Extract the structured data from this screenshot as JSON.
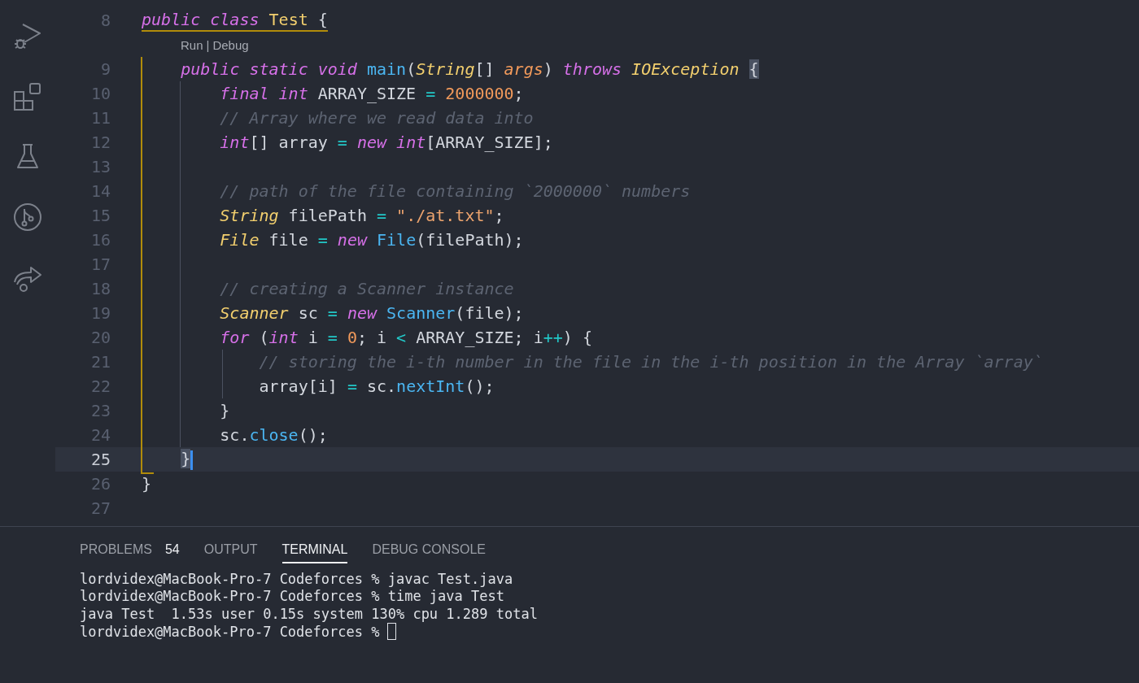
{
  "activity_bar": [
    {
      "kind": "run-debug",
      "selected": false
    },
    {
      "kind": "extensions",
      "selected": false
    },
    {
      "kind": "flask",
      "selected": false
    },
    {
      "kind": "branch",
      "selected": false
    },
    {
      "kind": "share",
      "selected": false
    }
  ],
  "editor": {
    "lines": [
      {
        "number": "8",
        "current": false,
        "tokens": [
          {
            "kind": "kw",
            "text": "public class "
          },
          {
            "kind": "cls",
            "text": "Test"
          },
          {
            "kind": "plain",
            "text": " {"
          }
        ],
        "codelens": {
          "links": [
            "Run",
            "Debug"
          ],
          "separator": "|"
        }
      },
      {
        "number": "9",
        "current": false,
        "tokens": [
          {
            "kind": "kw",
            "text": "    public static void "
          },
          {
            "kind": "fn",
            "text": "main"
          },
          {
            "kind": "plain",
            "text": "("
          },
          {
            "kind": "type",
            "text": "String"
          },
          {
            "kind": "plain",
            "text": "[] "
          },
          {
            "kind": "param",
            "text": "args"
          },
          {
            "kind": "plain",
            "text": ") "
          },
          {
            "kind": "kw",
            "text": "throws "
          },
          {
            "kind": "type",
            "text": "IOException "
          },
          {
            "kind": "bracket",
            "text": "{"
          }
        ]
      },
      {
        "number": "10",
        "current": false,
        "tokens": [
          {
            "kind": "kw",
            "text": "        final int"
          },
          {
            "kind": "plain",
            "text": " ARRAY_SIZE "
          },
          {
            "kind": "op",
            "text": "= "
          },
          {
            "kind": "num",
            "text": "2000000"
          },
          {
            "kind": "plain",
            "text": ";"
          }
        ]
      },
      {
        "number": "11",
        "current": false,
        "tokens": [
          {
            "kind": "cmt",
            "text": "        // Array where we read data into"
          }
        ]
      },
      {
        "number": "12",
        "current": false,
        "tokens": [
          {
            "kind": "kw",
            "text": "        int"
          },
          {
            "kind": "plain",
            "text": "[] array "
          },
          {
            "kind": "op",
            "text": "= "
          },
          {
            "kind": "kw",
            "text": "new int"
          },
          {
            "kind": "plain",
            "text": "[ARRAY_SIZE];"
          }
        ]
      },
      {
        "number": "13",
        "current": false
      },
      {
        "number": "14",
        "current": false,
        "tokens": [
          {
            "kind": "cmt",
            "text": "        // path of the file containing `2000000` numbers"
          }
        ]
      },
      {
        "number": "15",
        "current": false,
        "tokens": [
          {
            "kind": "type",
            "text": "        String"
          },
          {
            "kind": "plain",
            "text": " filePath "
          },
          {
            "kind": "op",
            "text": "= "
          },
          {
            "kind": "str",
            "text": "\"./at.txt\""
          },
          {
            "kind": "plain",
            "text": ";"
          }
        ]
      },
      {
        "number": "16",
        "current": false,
        "tokens": [
          {
            "kind": "type",
            "text": "        File"
          },
          {
            "kind": "plain",
            "text": " file "
          },
          {
            "kind": "op",
            "text": "= "
          },
          {
            "kind": "kw",
            "text": "new "
          },
          {
            "kind": "fn",
            "text": "File"
          },
          {
            "kind": "plain",
            "text": "(filePath);"
          }
        ]
      },
      {
        "number": "17",
        "current": false
      },
      {
        "number": "18",
        "current": false,
        "tokens": [
          {
            "kind": "cmt",
            "text": "        // creating a Scanner instance"
          }
        ]
      },
      {
        "number": "19",
        "current": false,
        "tokens": [
          {
            "kind": "type",
            "text": "        Scanner"
          },
          {
            "kind": "plain",
            "text": " sc "
          },
          {
            "kind": "op",
            "text": "= "
          },
          {
            "kind": "kw",
            "text": "new "
          },
          {
            "kind": "fn",
            "text": "Scanner"
          },
          {
            "kind": "plain",
            "text": "(file);"
          }
        ]
      },
      {
        "number": "20",
        "current": false,
        "tokens": [
          {
            "kind": "kw",
            "text": "        for"
          },
          {
            "kind": "plain",
            "text": " ("
          },
          {
            "kind": "kw",
            "text": "int"
          },
          {
            "kind": "plain",
            "text": " i "
          },
          {
            "kind": "op",
            "text": "= "
          },
          {
            "kind": "num",
            "text": "0"
          },
          {
            "kind": "plain",
            "text": "; i "
          },
          {
            "kind": "op",
            "text": "<"
          },
          {
            "kind": "plain",
            "text": " ARRAY_SIZE; i"
          },
          {
            "kind": "op",
            "text": "++"
          },
          {
            "kind": "plain",
            "text": ") {"
          }
        ]
      },
      {
        "number": "21",
        "current": false,
        "tokens": [
          {
            "kind": "cmt",
            "text": "            // storing the i-th number in the file in the i-th position in the Array `array`"
          }
        ]
      },
      {
        "number": "22",
        "current": false,
        "tokens": [
          {
            "kind": "plain",
            "text": "            array[i] "
          },
          {
            "kind": "op",
            "text": "="
          },
          {
            "kind": "plain",
            "text": " sc."
          },
          {
            "kind": "fn",
            "text": "nextInt"
          },
          {
            "kind": "plain",
            "text": "();"
          }
        ]
      },
      {
        "number": "23",
        "current": false,
        "tokens": [
          {
            "kind": "plain",
            "text": "        }"
          }
        ]
      },
      {
        "number": "24",
        "current": false,
        "tokens": [
          {
            "kind": "plain",
            "text": "        sc."
          },
          {
            "kind": "fn",
            "text": "close"
          },
          {
            "kind": "plain",
            "text": "();"
          }
        ]
      },
      {
        "number": "25",
        "current": true,
        "tokens": [
          {
            "kind": "bracket",
            "text": "    }"
          }
        ]
      },
      {
        "number": "26",
        "current": false,
        "tokens": [
          {
            "kind": "plain",
            "text": "}"
          }
        ]
      },
      {
        "number": "27",
        "current": false
      }
    ]
  },
  "panel": {
    "tabs": [
      {
        "label": "PROBLEMS",
        "badge": "54",
        "selected": false
      },
      {
        "label": "OUTPUT",
        "selected": false
      },
      {
        "label": "TERMINAL",
        "selected": true
      },
      {
        "label": "DEBUG CONSOLE",
        "selected": false
      }
    ],
    "terminal": {
      "lines": [
        "lordvidex@MacBook-Pro-7 Codeforces % javac Test.java",
        "lordvidex@MacBook-Pro-7 Codeforces % time java Test",
        "java Test  1.53s user 0.15s system 130% cpu 1.289 total",
        "lordvidex@MacBook-Pro-7 Codeforces %"
      ],
      "cursor": true
    }
  }
}
